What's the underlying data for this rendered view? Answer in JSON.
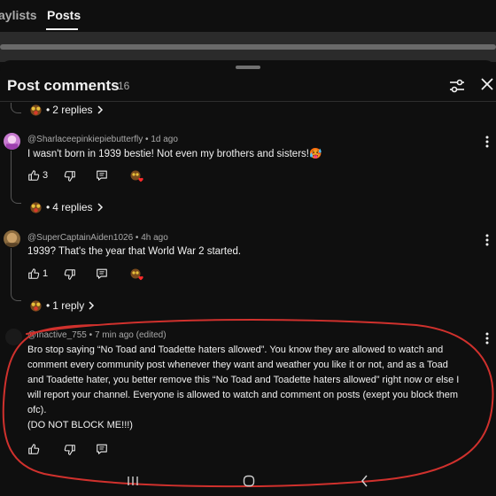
{
  "tabs": {
    "playlists_label": "aylists",
    "posts_label": "Posts"
  },
  "sheet": {
    "title": "Post comments",
    "count": "16"
  },
  "icons": {
    "filter": "filter-sliders-icon",
    "close": "close-icon",
    "like": "thumbs-up-icon",
    "dislike": "thumbs-down-icon",
    "reply": "reply-comment-icon",
    "creator_heart": "creator-heart-icon",
    "more": "more-vertical-icon",
    "chevron": "chevron-right-icon"
  },
  "colors": {
    "background": "#0f0f0f",
    "text": "#f1f1f1",
    "muted": "#aaaaaa",
    "heart": "#ff0000",
    "annotation": "#d0312d"
  },
  "threads": [
    {
      "replies_label": "2 replies"
    },
    {
      "author": "@Sharlaceepinkiepiebutterfly",
      "time": "1d ago",
      "text": "I wasn't born in 1939 bestie! Not even my brothers and sisters!🥵",
      "likes": "3",
      "replies_label": "4 replies"
    },
    {
      "author": "@SuperCaptainAiden1026",
      "time": "4h ago",
      "text": "1939? That's the year that World War 2 started.",
      "likes": "1",
      "replies_label": "1 reply"
    },
    {
      "author": "@Inactive_755",
      "time": "7 min ago (edited)",
      "text_lines": [
        "Bro stop saying “No Toad and Toadette haters allowed”. You know they are allowed to watch and",
        "comment every community post whenever they want and weather you like it or not, and as a Toad",
        "and Toadette hater, you better remove this “No Toad and Toadette haters allowed” right now or else I",
        "will report your channel. Everyone is allowed to watch and comment on posts (exept you block them",
        "ofc).",
        "(DO NOT BLOCK ME!!!)"
      ]
    }
  ],
  "separator": "•"
}
